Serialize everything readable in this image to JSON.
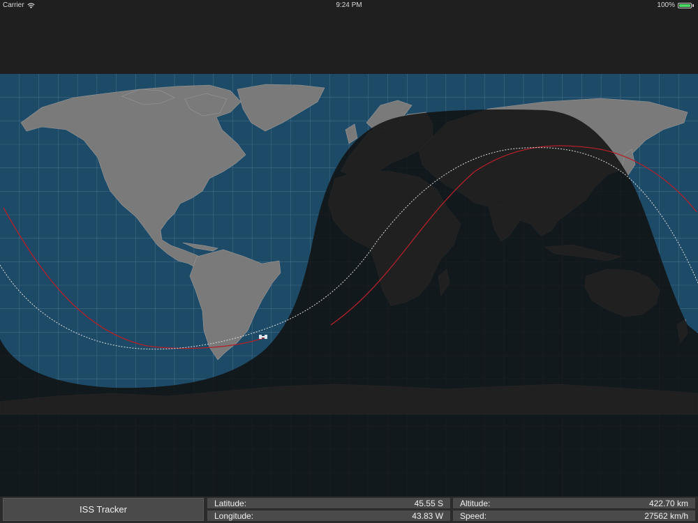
{
  "status_bar": {
    "carrier": "Carrier",
    "time": "9:24 PM",
    "battery": "100%",
    "battery_level": 1.0
  },
  "map": {
    "ocean_color": "#1d4a66",
    "land_color": "#7a7a7a",
    "night_color": "#111111",
    "orbit_color": "#b3202a",
    "future_orbit_color": "#e0e0e0"
  },
  "bottom_bar": {
    "title_button": "ISS Tracker",
    "latitude_label": "Latitude:",
    "latitude_value": "45.55 S",
    "longitude_label": "Longitude:",
    "longitude_value": "43.83 W",
    "altitude_label": "Altitude:",
    "altitude_value": "422.70 km",
    "speed_label": "Speed:",
    "speed_value": "27562 km/h"
  }
}
